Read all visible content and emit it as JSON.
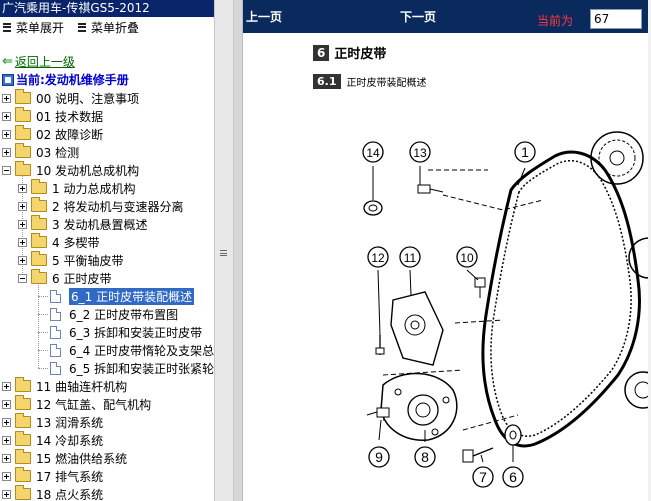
{
  "left_panel": {
    "title": "广汽乘用车-传祺GS5-2012",
    "expand_menu": "菜单展开",
    "collapse_menu": "菜单折叠",
    "back_link": "返回上一级",
    "current_label": "当前:发动机维修手册",
    "tree": [
      {
        "label": "00 说明、注意事项",
        "state": "collapsed"
      },
      {
        "label": "01 技术数据",
        "state": "collapsed"
      },
      {
        "label": "02 故障诊断",
        "state": "collapsed"
      },
      {
        "label": "03 检测",
        "state": "collapsed"
      },
      {
        "label": "10 发动机总成机构",
        "state": "expanded"
      },
      {
        "label": "1 动力总成机构",
        "state": "collapsed"
      },
      {
        "label": "2 将发动机与变速器分离",
        "state": "collapsed"
      },
      {
        "label": "3 发动机悬置概述",
        "state": "collapsed"
      },
      {
        "label": "4 多楔带",
        "state": "collapsed"
      },
      {
        "label": "5 平衡轴皮带",
        "state": "collapsed"
      },
      {
        "label": "6 正时皮带",
        "state": "expanded"
      },
      {
        "label": "6_1 正时皮带装配概述",
        "state": "selected"
      },
      {
        "label": "6_2 正时皮带布置图",
        "state": "leaf"
      },
      {
        "label": "6_3 拆卸和安装正时皮带",
        "state": "leaf"
      },
      {
        "label": "6_4 正时皮带惰轮及支架总",
        "state": "leaf"
      },
      {
        "label": "6_5 拆卸和安装正时张紧轮",
        "state": "leaf"
      },
      {
        "label": "11 曲轴连杆机构",
        "state": "collapsed"
      },
      {
        "label": "12 气缸盖、配气机构",
        "state": "collapsed"
      },
      {
        "label": "13 润滑系统",
        "state": "collapsed"
      },
      {
        "label": "14 冷却系统",
        "state": "collapsed"
      },
      {
        "label": "15 燃油供给系统",
        "state": "collapsed"
      },
      {
        "label": "17 排气系统",
        "state": "collapsed"
      },
      {
        "label": "18 点火系统",
        "state": "collapsed"
      }
    ]
  },
  "toolbar": {
    "prev": "上一页",
    "next": "下一页",
    "current_page_label": "当前为",
    "current_page_value": "67"
  },
  "content": {
    "section_num": "6",
    "section_title": "正时皮带",
    "subsection_num": "6.1",
    "subsection_title": "正时皮带装配概述",
    "callouts": [
      "14",
      "13",
      "1",
      "12",
      "11",
      "10",
      "9",
      "8",
      "7",
      "6"
    ]
  },
  "colors": {
    "title_bar": "#0a246a",
    "nav_bar": "#0a2a5e",
    "selected_item": "#316ac5",
    "page_label": "#ff3a3a",
    "back_link": "#006600"
  }
}
